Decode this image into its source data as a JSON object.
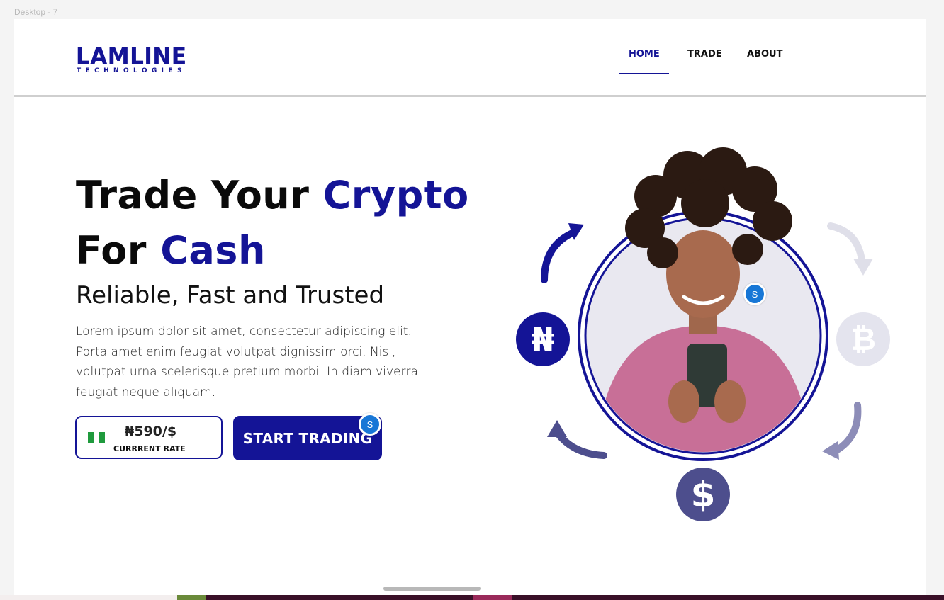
{
  "frame_label": "Desktop - 7",
  "brand": {
    "name": "LAMLINE",
    "tagline": "TECHNOLOGIES",
    "color": "#141496"
  },
  "nav": {
    "items": [
      {
        "label": "HOME",
        "active": true
      },
      {
        "label": "TRADE",
        "active": false
      },
      {
        "label": "ABOUT",
        "active": false
      }
    ]
  },
  "hero": {
    "headline_part1": "Trade Your ",
    "headline_accent1": "Crypto",
    "headline_part2": "For ",
    "headline_accent2": "Cash",
    "subheading": "Reliable, Fast and Trusted",
    "body": "Lorem ipsum dolor sit amet, consectetur adipiscing elit. Porta amet enim feugiat volutpat dignissim orci. Nisi, volutpat urna scelerisque pretium morbi. In diam viverra feugiat neque aliquam.",
    "rate_value": "₦590/$",
    "rate_label": "CURRRENT RATE",
    "cta_label": "START TRADING"
  },
  "badges": {
    "s_label": "S"
  },
  "illustration": {
    "naira_symbol": "₦",
    "bitcoin_symbol": "₿",
    "dollar_symbol": "$",
    "icons": [
      "naira-coin-icon",
      "bitcoin-coin-icon",
      "dollar-coin-icon",
      "cycle-arrow-icon"
    ]
  },
  "colors": {
    "accent": "#141496",
    "dollar_coin": "#4d4e8d",
    "bitcoin_coin": "#e4e4ee",
    "badge_blue": "#1877d6"
  }
}
